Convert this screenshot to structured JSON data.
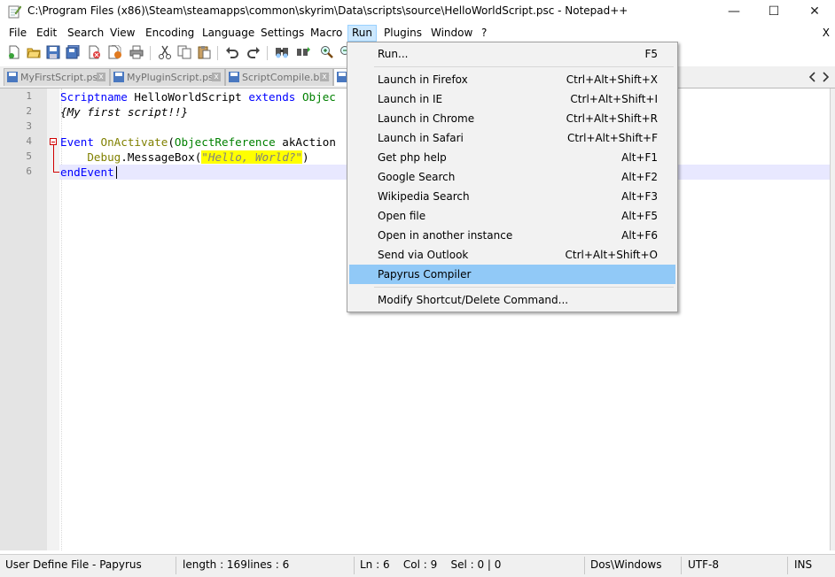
{
  "window": {
    "title": "C:\\Program Files (x86)\\Steam\\steamapps\\common\\skyrim\\Data\\scripts\\source\\HelloWorldScript.psc - Notepad++",
    "controls": {
      "minimize": "—",
      "maximize": "☐",
      "close": "✕"
    }
  },
  "menubar": {
    "items": [
      "File",
      "Edit",
      "Search",
      "View",
      "Encoding",
      "Language",
      "Settings",
      "Macro",
      "Run",
      "Plugins",
      "Window",
      "?"
    ],
    "active": "Run",
    "doc_close": "X"
  },
  "tabs": [
    {
      "label": "MyFirstScript.psc",
      "close": "x"
    },
    {
      "label": "MyPluginScript.psc",
      "close": "x"
    },
    {
      "label": "ScriptCompile.bat",
      "close": "x"
    },
    {
      "label": ""
    }
  ],
  "editor": {
    "line_numbers": [
      "1",
      "2",
      "3",
      "4",
      "5",
      "6"
    ],
    "lines": {
      "l1": {
        "kw1": "Scriptname",
        "name": " HelloWorldScript ",
        "kw2": "extends",
        "type": " Objec"
      },
      "l2": {
        "comment": "{My first script!!}"
      },
      "l4": {
        "kw": "Event",
        "fn": " OnActivate",
        "paren": "(",
        "type": "ObjectReference",
        "arg": " akAction"
      },
      "l5": {
        "indent": "    ",
        "obj": "Debug",
        "dot": ".",
        "method": "MessageBox",
        "open": "(",
        "str": "\"Hello, World?\"",
        "close": ")"
      },
      "l6": {
        "kw": "endEvent"
      }
    },
    "current_line": 6
  },
  "run_menu": {
    "items": [
      {
        "label": "Run...",
        "shortcut": "F5"
      },
      {
        "label": "Launch in Firefox",
        "shortcut": "Ctrl+Alt+Shift+X"
      },
      {
        "label": "Launch in IE",
        "shortcut": "Ctrl+Alt+Shift+I"
      },
      {
        "label": "Launch in Chrome",
        "shortcut": "Ctrl+Alt+Shift+R"
      },
      {
        "label": "Launch in Safari",
        "shortcut": "Ctrl+Alt+Shift+F"
      },
      {
        "label": "Get php help",
        "shortcut": "Alt+F1"
      },
      {
        "label": "Google Search",
        "shortcut": "Alt+F2"
      },
      {
        "label": "Wikipedia Search",
        "shortcut": "Alt+F3"
      },
      {
        "label": "Open file",
        "shortcut": "Alt+F5"
      },
      {
        "label": "Open in another instance",
        "shortcut": "Alt+F6"
      },
      {
        "label": "Send via Outlook",
        "shortcut": "Ctrl+Alt+Shift+O"
      },
      {
        "label": "Papyrus Compiler",
        "shortcut": ""
      },
      {
        "label": "Modify Shortcut/Delete Command...",
        "shortcut": ""
      }
    ],
    "highlighted": "Papyrus Compiler"
  },
  "statusbar": {
    "file_type": "User Define File - Papyrus",
    "length": "length : 169",
    "lines": "lines : 6",
    "position": "Ln : 6    Col : 9    Sel : 0 | 0",
    "eol": "Dos\\Windows",
    "encoding": "UTF-8",
    "mode": "INS"
  },
  "icons": {
    "app": "notepad-icon",
    "toolbar": [
      "new-file-icon",
      "open-file-icon",
      "save-icon",
      "save-all-icon",
      "close-icon",
      "close-all-icon",
      "print-icon",
      "cut-icon",
      "copy-icon",
      "paste-icon",
      "undo-icon",
      "redo-icon",
      "find-icon",
      "replace-icon",
      "zoom-in-icon",
      "zoom-out-icon"
    ]
  },
  "colors": {
    "keyword": "#0000ff",
    "type": "#008000",
    "string_bg": "#ffff00",
    "menu_highlight": "#91c9f7",
    "current_line": "#e8e8ff",
    "fold_marker": "#d00000"
  }
}
